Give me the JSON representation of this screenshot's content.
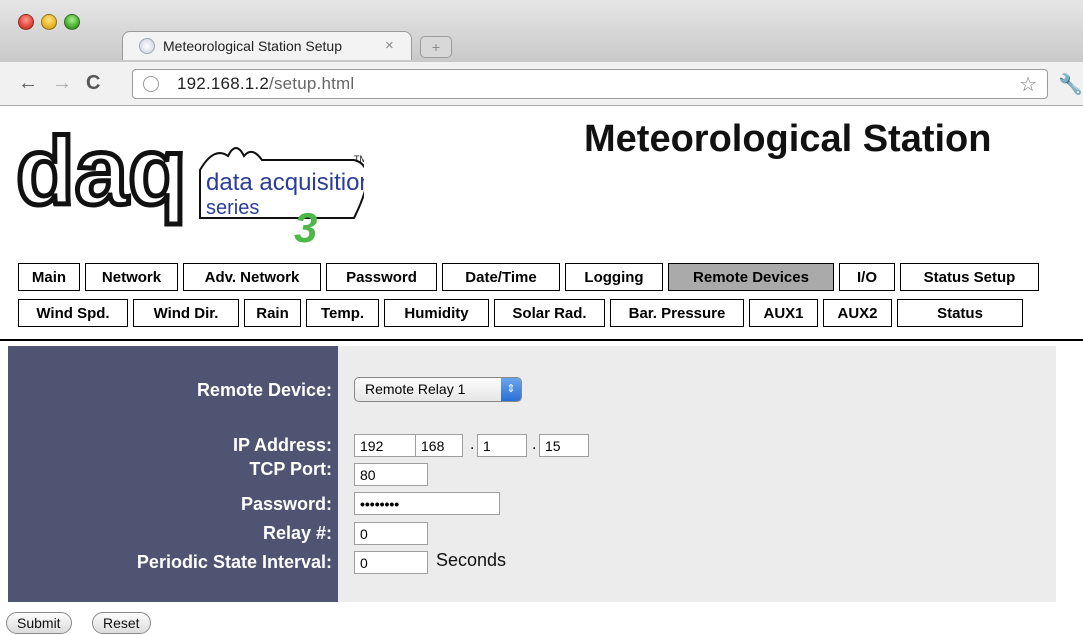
{
  "browser": {
    "tab_title": "Meteorological Station Setup",
    "tab_close": "×",
    "new_tab": "+",
    "url_host": "192.168.1.2",
    "url_path": "/setup.html",
    "star": "☆",
    "wrench": "🔧"
  },
  "header": {
    "title": "Meteorological Station",
    "logo": {
      "main": "daq",
      "line1": "data acquisition",
      "line2": "series",
      "mark": "3",
      "tm": "TM"
    }
  },
  "nav": {
    "row1": [
      "Main",
      "Network",
      "Adv. Network",
      "Password",
      "Date/Time",
      "Logging",
      "Remote Devices",
      "I/O",
      "Status Setup"
    ],
    "row2": [
      "Wind Spd.",
      "Wind Dir.",
      "Rain",
      "Temp.",
      "Humidity",
      "Solar Rad.",
      "Bar. Pressure",
      "AUX1",
      "AUX2",
      "Status"
    ],
    "active": "Remote Devices"
  },
  "form": {
    "remote_device_label": "Remote Device:",
    "remote_device_value": "Remote Relay 1",
    "ip_label": "IP Address:",
    "ip": [
      "192",
      "168",
      "1",
      "15"
    ],
    "tcp_label": "TCP Port:",
    "tcp_value": "80",
    "password_label": "Password:",
    "password_value": "••••••••",
    "relay_label": "Relay #:",
    "relay_value": "0",
    "interval_label": "Periodic State Interval:",
    "interval_value": "0",
    "interval_unit": "Seconds"
  },
  "buttons": {
    "submit": "Submit",
    "reset": "Reset"
  },
  "colors": {
    "panel_left": "#4e5471",
    "panel_right": "#ececec",
    "active_tab": "#aaaaaa",
    "logo_green": "#4bb848"
  }
}
